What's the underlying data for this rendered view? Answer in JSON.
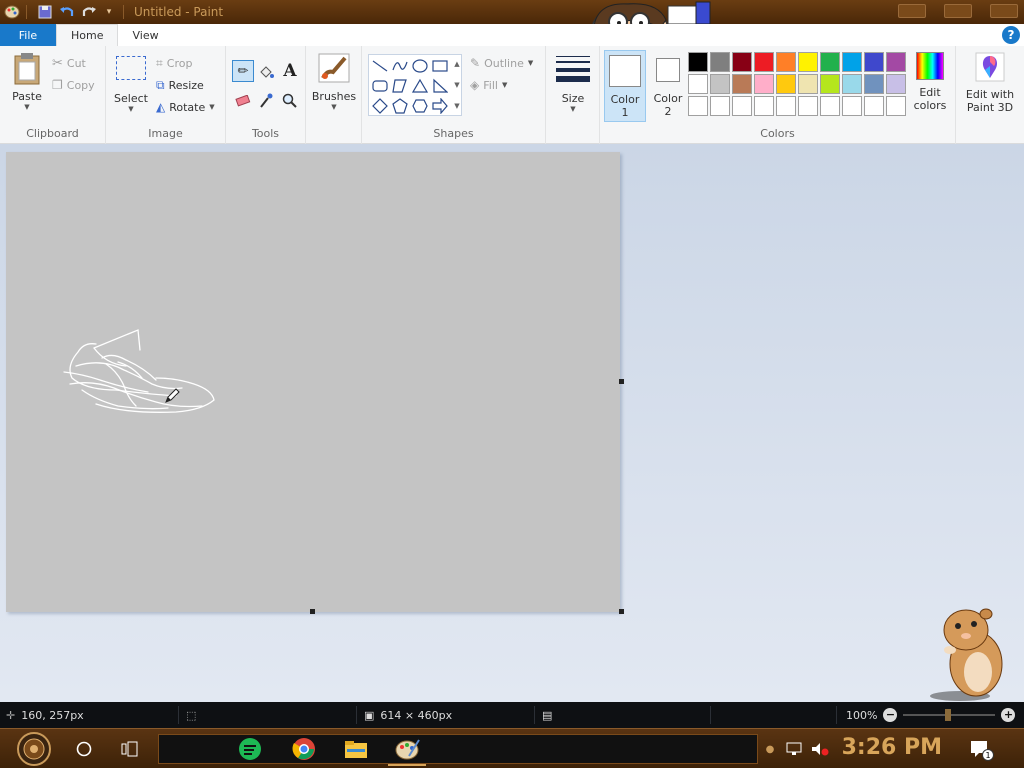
{
  "window": {
    "title": "Untitled - Paint"
  },
  "tabs": [
    {
      "label": "File"
    },
    {
      "label": "Home"
    },
    {
      "label": "View"
    }
  ],
  "help": {
    "label": "?"
  },
  "ribbon": {
    "clipboard": {
      "label": "Clipboard",
      "paste": "Paste",
      "cut": "Cut",
      "copy": "Copy"
    },
    "image": {
      "label": "Image",
      "select": "Select",
      "crop": "Crop",
      "resize": "Resize",
      "rotate": "Rotate"
    },
    "tools": {
      "label": "Tools",
      "text_glyph": "A"
    },
    "brushes": {
      "label": "Brushes"
    },
    "shapes": {
      "label": "Shapes",
      "outline": "Outline",
      "fill": "Fill"
    },
    "size": {
      "label": "Size"
    },
    "color1": {
      "label": "Color",
      "num": "1"
    },
    "color2": {
      "label": "Color",
      "num": "2"
    },
    "colors": {
      "label": "Colors",
      "edit_line1": "Edit",
      "edit_line2": "colors",
      "palette_row1": [
        "#000000",
        "#7f7f7f",
        "#880015",
        "#ed1c24",
        "#ff7f27",
        "#fff200",
        "#22b14c",
        "#00a2e8",
        "#3f48cc",
        "#a349a4"
      ],
      "palette_row2": [
        "#ffffff",
        "#c3c3c3",
        "#b97a57",
        "#ffaec9",
        "#ffc90e",
        "#efe4b0",
        "#b5e61d",
        "#99d9ea",
        "#7092be",
        "#c8bfe7"
      ],
      "palette_row3": [
        "#ffffff",
        "#ffffff",
        "#ffffff",
        "#ffffff",
        "#ffffff",
        "#ffffff",
        "#ffffff",
        "#ffffff",
        "#ffffff",
        "#ffffff"
      ]
    },
    "paint3d": {
      "line1": "Edit with",
      "line2": "Paint 3D"
    }
  },
  "statusbar": {
    "cursor_pos": "160, 257px",
    "canvas_size": "614 × 460px",
    "zoom": "100%"
  },
  "taskbar": {
    "clock": "3:26 PM",
    "notification_count": "1"
  },
  "colors": {
    "accent": "#1979ca",
    "canvas": "#c4c4c4",
    "clock": "#d8a55a"
  }
}
